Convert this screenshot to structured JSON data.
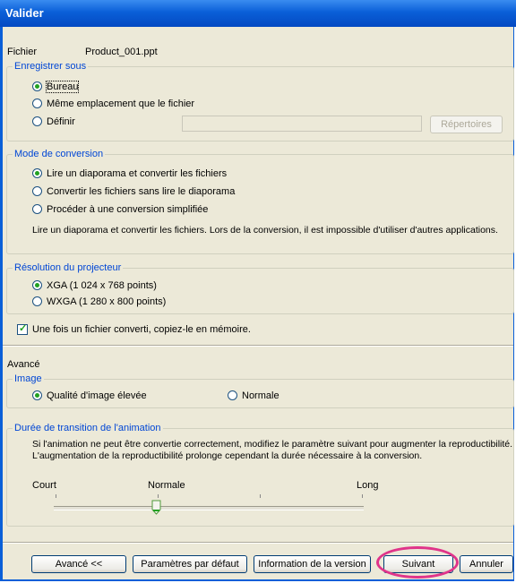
{
  "window": {
    "title": "Valider"
  },
  "file": {
    "label": "Fichier",
    "value": "Product_001.ppt"
  },
  "save": {
    "legend": "Enregistrer sous",
    "options": [
      {
        "label": "Bureau",
        "selected": true
      },
      {
        "label": "Même emplacement que le fichier",
        "selected": false
      },
      {
        "label": "Définir",
        "selected": false
      }
    ],
    "path_value": "",
    "browse_button": "Répertoires"
  },
  "conversion": {
    "legend": "Mode de conversion",
    "options": [
      {
        "label": "Lire un diaporama et convertir les fichiers",
        "selected": true
      },
      {
        "label": "Convertir les fichiers sans lire le diaporama",
        "selected": false
      },
      {
        "label": "Procéder à une conversion simplifiée",
        "selected": false
      }
    ],
    "description": "Lire un diaporama et convertir les fichiers. Lors de la conversion, il est impossible d'utiliser d'autres applications."
  },
  "resolution": {
    "legend": "Résolution du projecteur",
    "options": [
      {
        "label": "XGA (1 024 x 768 points)",
        "selected": true
      },
      {
        "label": "WXGA (1 280 x 800 points)",
        "selected": false
      }
    ]
  },
  "copy_memory": {
    "label": "Une fois un fichier converti, copiez-le en mémoire.",
    "checked": true
  },
  "advanced": {
    "heading": "Avancé",
    "image_legend": "Image",
    "image_options": [
      {
        "label": "Qualité d'image élevée",
        "selected": true
      },
      {
        "label": "Normale",
        "selected": false
      }
    ],
    "animation_legend": "Durée de transition de l'animation",
    "animation_desc_1": "Si l'animation ne peut être convertie correctement, modifiez le paramètre suivant pour augmenter la reproductibilité.",
    "animation_desc_2": "L'augmentation de la reproductibilité prolonge cependant la durée nécessaire à la conversion.",
    "slider_labels": {
      "min": "Court",
      "mid": "Normale",
      "max": "Long"
    },
    "slider_value_fraction": 0.33
  },
  "footer": {
    "advanced_button": "Avancé <<",
    "defaults_button": "Paramètres par défaut",
    "version_button": "Information de la version",
    "next_button": "Suivant",
    "cancel_button": "Annuler"
  },
  "colors": {
    "title_bar": "#0a5fd8",
    "legend_text": "#0046d5",
    "highlight_ring": "#e0348a",
    "dialog_bg": "#ece9d8"
  }
}
